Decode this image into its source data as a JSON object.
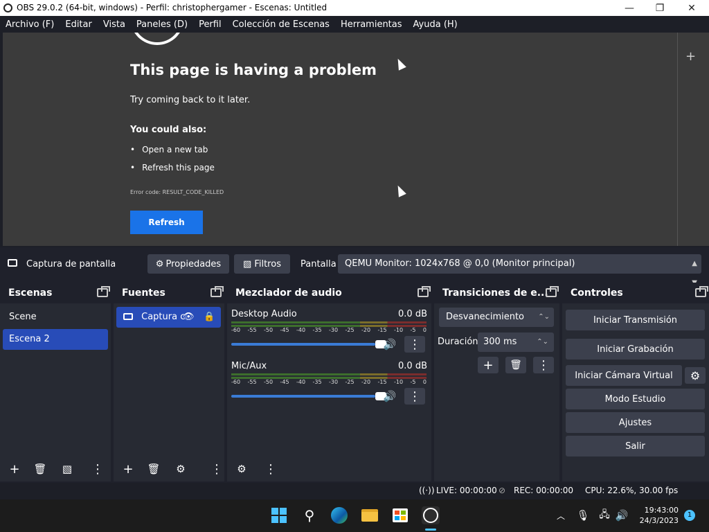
{
  "window": {
    "title": "OBS 29.0.2 (64-bit, windows) - Perfil: christophergamer - Escenas: Untitled"
  },
  "menu": [
    "Archivo (F)",
    "Editar",
    "Vista",
    "Paneles (D)",
    "Perfil",
    "Colección de Escenas",
    "Herramientas",
    "Ayuda (H)"
  ],
  "preview": {
    "title": "This page is having a problem",
    "subtitle": "Try coming back to it later.",
    "also": "You could also:",
    "items": [
      "Open a new tab",
      "Refresh this page"
    ],
    "error_code": "Error code: RESULT_CODE_KILLED",
    "refresh_label": "Refresh"
  },
  "source_bar": {
    "source_name": "Captura de pantalla",
    "properties_label": "Propiedades",
    "filters_label": "Filtros",
    "screen_label": "Pantalla",
    "monitor_value": "QEMU Monitor: 1024x768 @ 0,0 (Monitor principal)"
  },
  "scenes": {
    "title": "Escenas",
    "items": [
      "Scene",
      "Escena 2"
    ]
  },
  "sources": {
    "title": "Fuentes",
    "items": [
      "Captura c"
    ]
  },
  "mixer": {
    "title": "Mezclador de audio",
    "ticks": [
      "-60",
      "-55",
      "-50",
      "-45",
      "-40",
      "-35",
      "-30",
      "-25",
      "-20",
      "-15",
      "-10",
      "-5",
      "0"
    ],
    "channels": [
      {
        "name": "Desktop Audio",
        "db": "0.0 dB"
      },
      {
        "name": "Mic/Aux",
        "db": "0.0 dB"
      }
    ]
  },
  "transitions": {
    "title": "Transiciones de e...",
    "selected": "Desvanecimiento",
    "duration_label": "Duración",
    "duration_value": "300 ms"
  },
  "controls": {
    "title": "Controles",
    "start_stream": "Iniciar Transmisión",
    "start_record": "Iniciar Grabación",
    "virtual_cam": "Iniciar Cámara Virtual",
    "studio_mode": "Modo Estudio",
    "settings": "Ajustes",
    "exit": "Salir"
  },
  "status": {
    "live": "LIVE: 00:00:00",
    "rec": "REC: 00:00:00",
    "cpu": "CPU: 22.6%, 30.00 fps"
  },
  "taskbar": {
    "time": "19:43:00",
    "date": "24/3/2023",
    "notifications": "1"
  },
  "colors": {
    "accent": "#284cb8",
    "refresh_blue": "#1a73e8",
    "panel": "#272a33"
  }
}
